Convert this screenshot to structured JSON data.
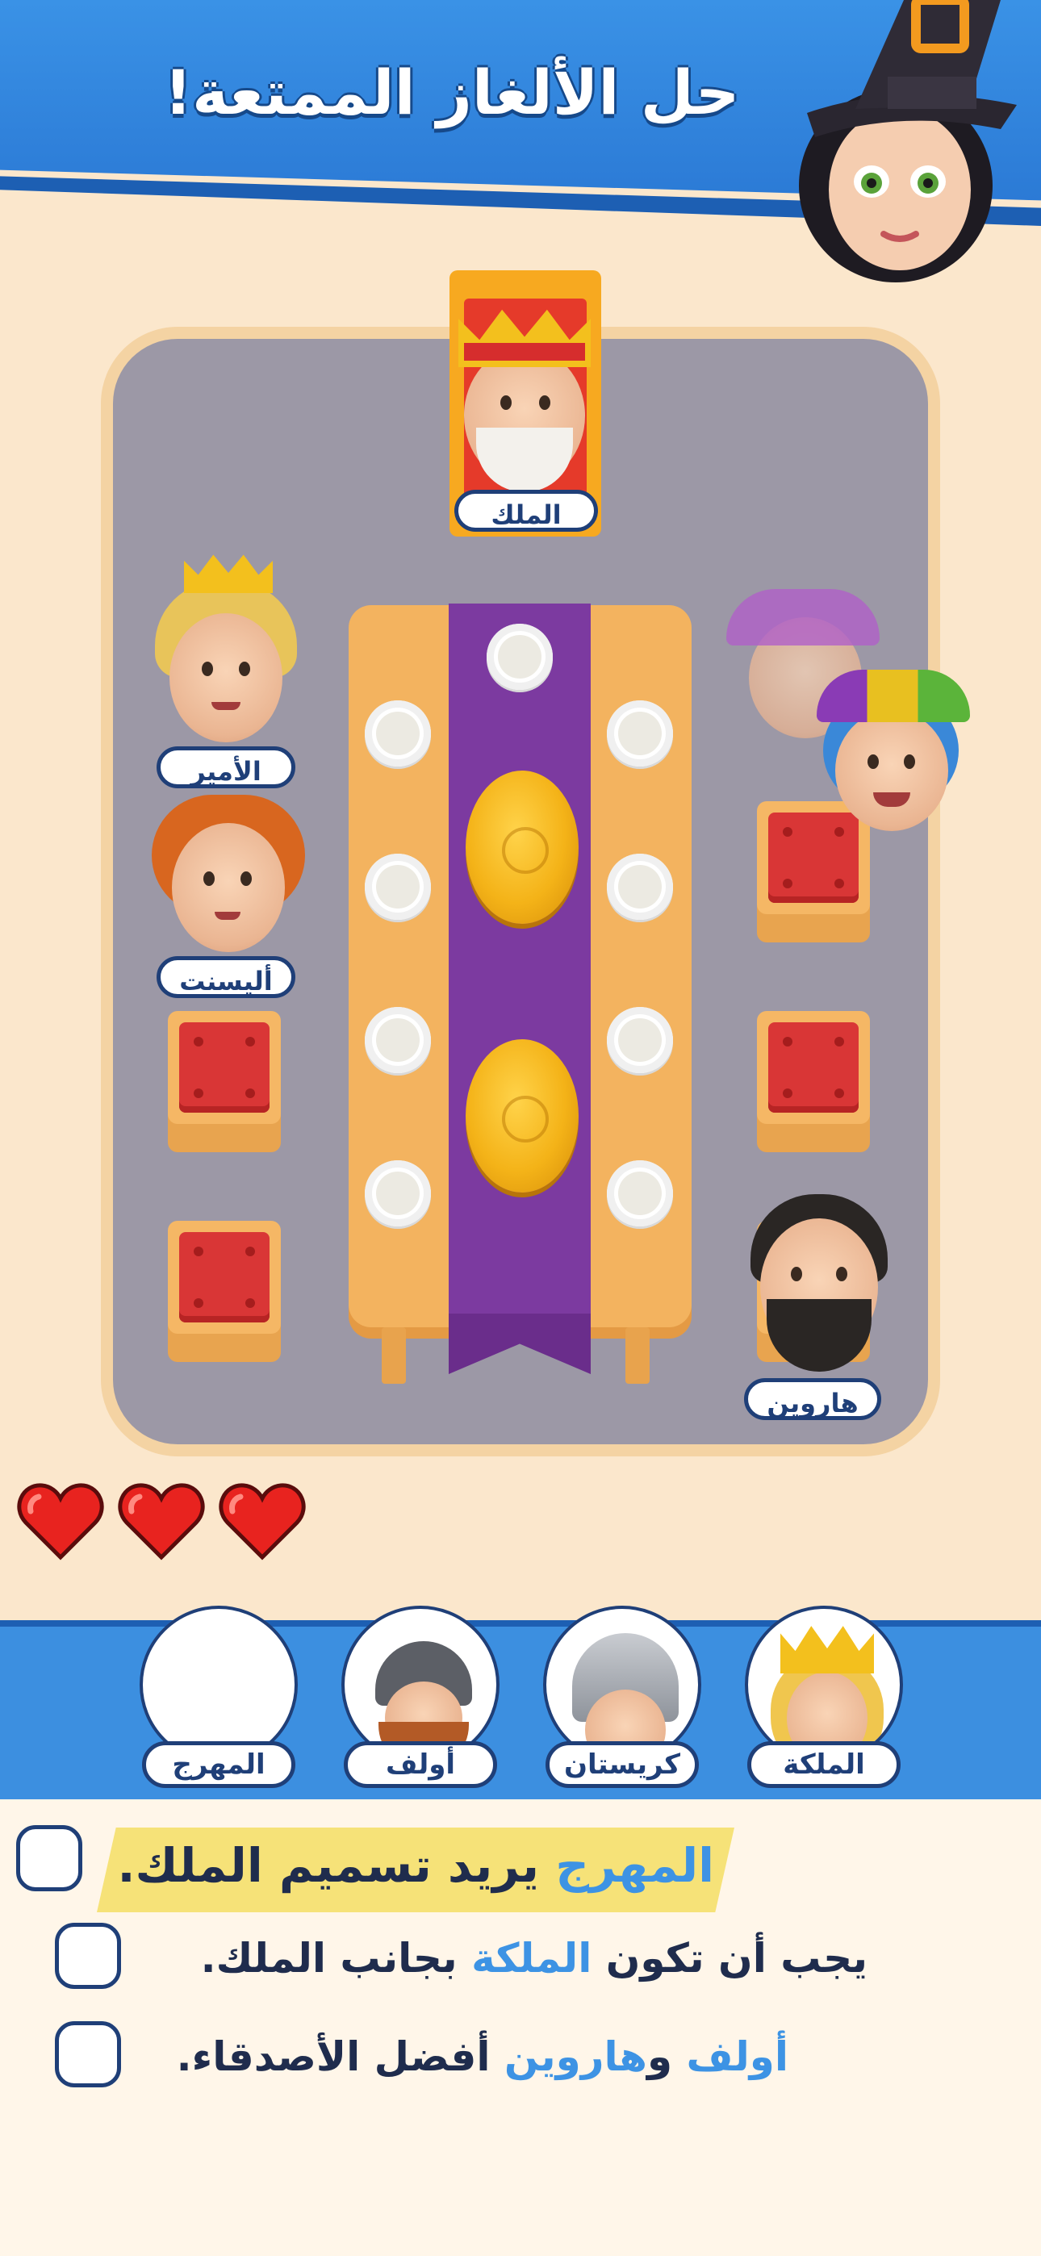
{
  "header": {
    "title": "حل الألغاز الممتعة!"
  },
  "board": {
    "seated": [
      {
        "id": "king",
        "name": "الملك"
      },
      {
        "id": "prince",
        "name": "الأمير"
      },
      {
        "id": "ilysent",
        "name": "أليسنت"
      },
      {
        "id": "harwin",
        "name": "هاروين"
      }
    ]
  },
  "lives": {
    "hearts": 3
  },
  "candidates": [
    {
      "id": "queen",
      "name": "الملكة"
    },
    {
      "id": "kristan",
      "name": "كريستان"
    },
    {
      "id": "olaf",
      "name": "أولف"
    },
    {
      "id": "jester",
      "name": "المهرج"
    }
  ],
  "clues": [
    {
      "parts": [
        "المهرج",
        " يريد تسميم الملك."
      ],
      "highlight": [
        0
      ],
      "checked": false
    },
    {
      "parts": [
        "يجب أن تكون ",
        "الملكة",
        " بجانب الملك."
      ],
      "highlight": [
        1
      ],
      "checked": false
    },
    {
      "parts": [
        "أولف",
        " و",
        "هاروين",
        " أفضل الأصدقاء."
      ],
      "highlight": [
        0,
        2
      ],
      "checked": false
    }
  ],
  "colors": {
    "header_blue": "#2a78d4",
    "accent_blue": "#3d93e4",
    "navy": "#1f3f78",
    "highlight_yellow": "#f6e278",
    "heart_red": "#e8231f"
  }
}
